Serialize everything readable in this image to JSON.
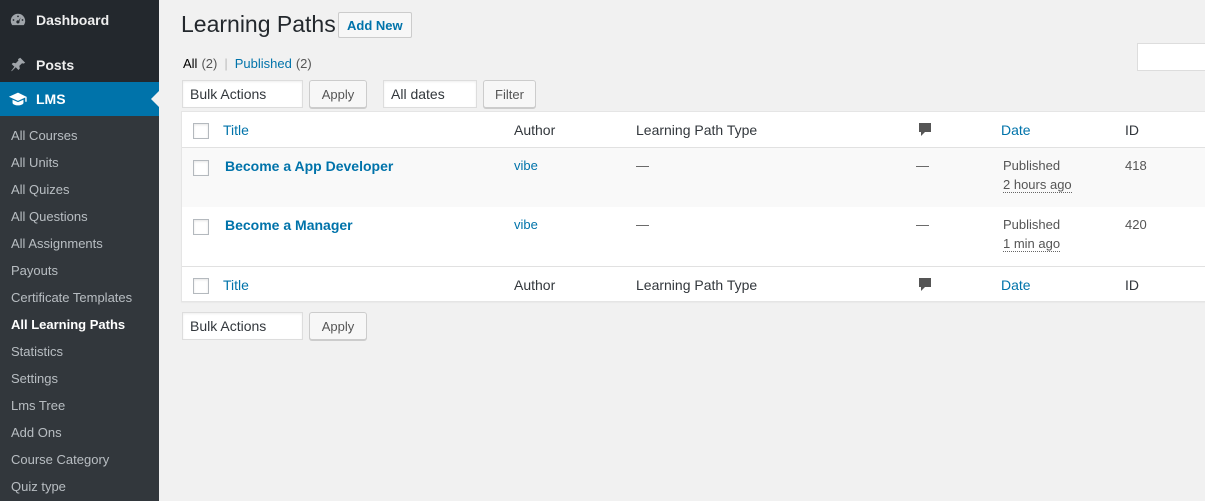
{
  "sidebar": {
    "top": [
      {
        "label": "Dashboard",
        "icon": "dashboard-icon"
      },
      {
        "label": "Posts",
        "icon": "pin-icon"
      },
      {
        "label": "LMS",
        "icon": "graduation-cap-icon"
      }
    ],
    "submenu": [
      "All Courses",
      "All Units",
      "All Quizes",
      "All Questions",
      "All Assignments",
      "Payouts",
      "Certificate Templates",
      "All Learning Paths",
      "Statistics",
      "Settings",
      "Lms Tree",
      "Add Ons",
      "Course Category",
      "Quiz type"
    ],
    "active_submenu": "All Learning Paths"
  },
  "page": {
    "title": "Learning Paths",
    "add_new": "Add New",
    "filters": {
      "all_label": "All",
      "all_count": "(2)",
      "separator": "|",
      "published_label": "Published",
      "published_count": "(2)"
    },
    "bulk_actions": "Bulk Actions",
    "apply": "Apply",
    "dates": "All dates",
    "filter": "Filter"
  },
  "table": {
    "columns": {
      "title": "Title",
      "author": "Author",
      "type": "Learning Path Type",
      "comments_icon": "comment-bubble-icon",
      "date": "Date",
      "id": "ID"
    },
    "rows": [
      {
        "title": "Become a App Developer",
        "author": "vibe",
        "type": "—",
        "comments": "—",
        "status": "Published",
        "ago": "2 hours ago",
        "id": "418"
      },
      {
        "title": "Become a Manager",
        "author": "vibe",
        "type": "—",
        "comments": "—",
        "status": "Published",
        "ago": "1 min ago",
        "id": "420"
      }
    ]
  },
  "colors": {
    "sidebar_bg": "#23282d",
    "submenu_bg": "#32373c",
    "accent": "#0073aa",
    "page_bg": "#f1f1f1"
  }
}
